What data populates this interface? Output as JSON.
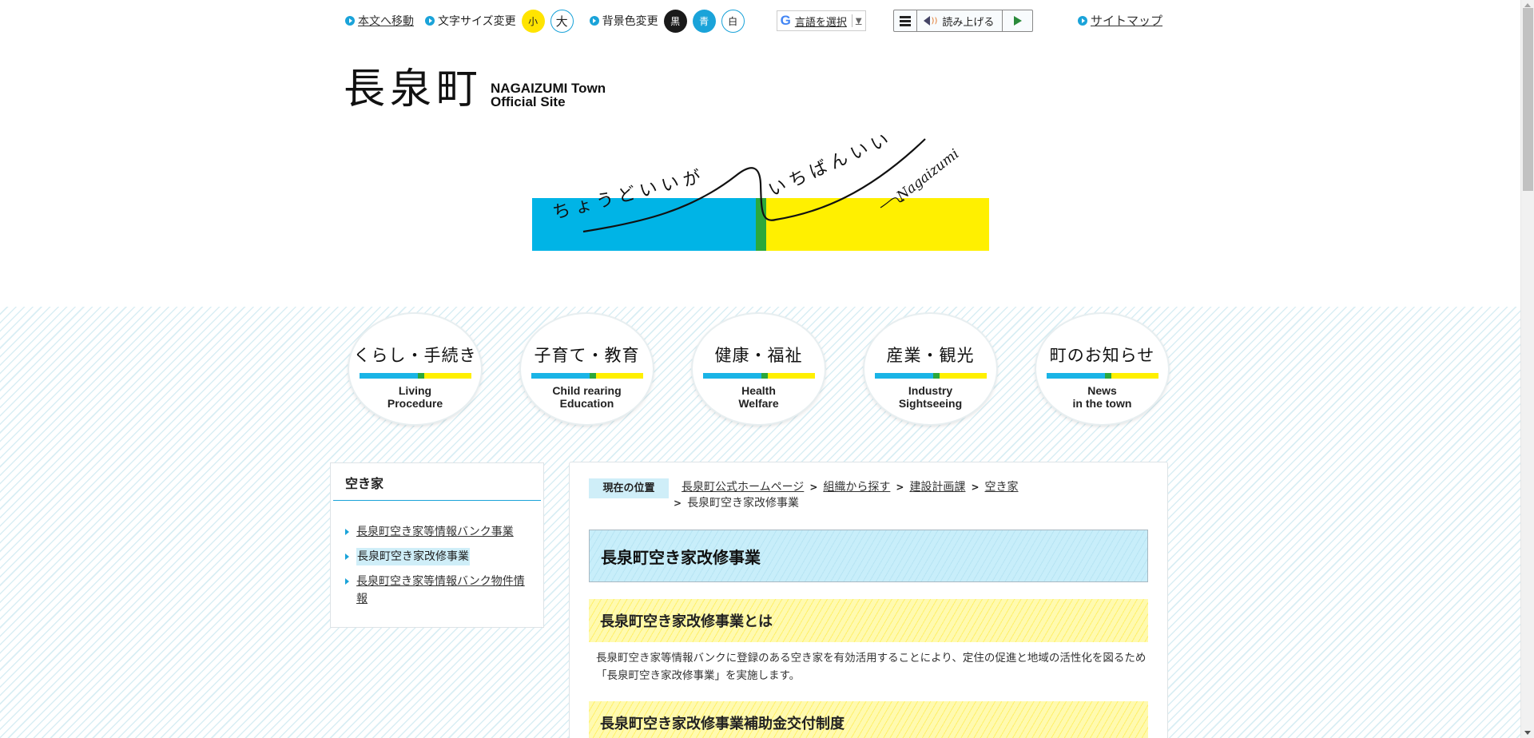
{
  "utility": {
    "skip_link": "本文へ移動",
    "font_size_label": "文字サイズ変更",
    "font_small": "小",
    "font_large": "大",
    "bg_color_label": "背景色変更",
    "bg_black": "黒",
    "bg_blue": "青",
    "bg_white": "白",
    "translate_logo": "G",
    "translate_label": "言語を選択",
    "translate_arrow": "▼",
    "reader_label": "読み上げる",
    "reader_wave": "))",
    "sitemap_link": "サイトマップ"
  },
  "logo": {
    "jp": "長泉町",
    "en_line1": "NAGAIZUMI Town",
    "en_line2": "Official Site"
  },
  "hero": {
    "text_left": "ちょうどいいが",
    "text_right": "いちばんいい",
    "signature": "Nagaizumi",
    "colors": {
      "blue": "#00b4e6",
      "green": "#2ba83b",
      "yellow": "#fff000"
    }
  },
  "categories": [
    {
      "jp": "くらし・手続き",
      "en1": "Living",
      "en2": "Procedure"
    },
    {
      "jp": "子育て・教育",
      "en1": "Child rearing",
      "en2": "Education"
    },
    {
      "jp": "健康・福祉",
      "en1": "Health",
      "en2": "Welfare"
    },
    {
      "jp": "産業・観光",
      "en1": "Industry",
      "en2": "Sightseeing"
    },
    {
      "jp": "町のお知らせ",
      "en1": "News",
      "en2": "in the town"
    }
  ],
  "sidebar": {
    "title": "空き家",
    "items": [
      {
        "label": "長泉町空き家等情報バンク事業"
      },
      {
        "label": "長泉町空き家改修事業"
      },
      {
        "label": "長泉町空き家等情報バンク物件情報"
      }
    ]
  },
  "breadcrumb": {
    "here_label": "現在の位置",
    "sep": ">",
    "items": [
      "長泉町公式ホームページ",
      "組織から探す",
      "建設計画課",
      "空き家"
    ],
    "current": "長泉町空き家改修事業"
  },
  "content": {
    "title": "長泉町空き家改修事業",
    "section1_heading": "長泉町空き家改修事業とは",
    "section1_text": "長泉町空き家等情報バンクに登録のある空き家を有効活用することにより、定住の促進と地域の活性化を図るため「長泉町空き家改修事業」を実施します。",
    "section2_heading": "長泉町空き家改修事業補助金交付制度"
  }
}
